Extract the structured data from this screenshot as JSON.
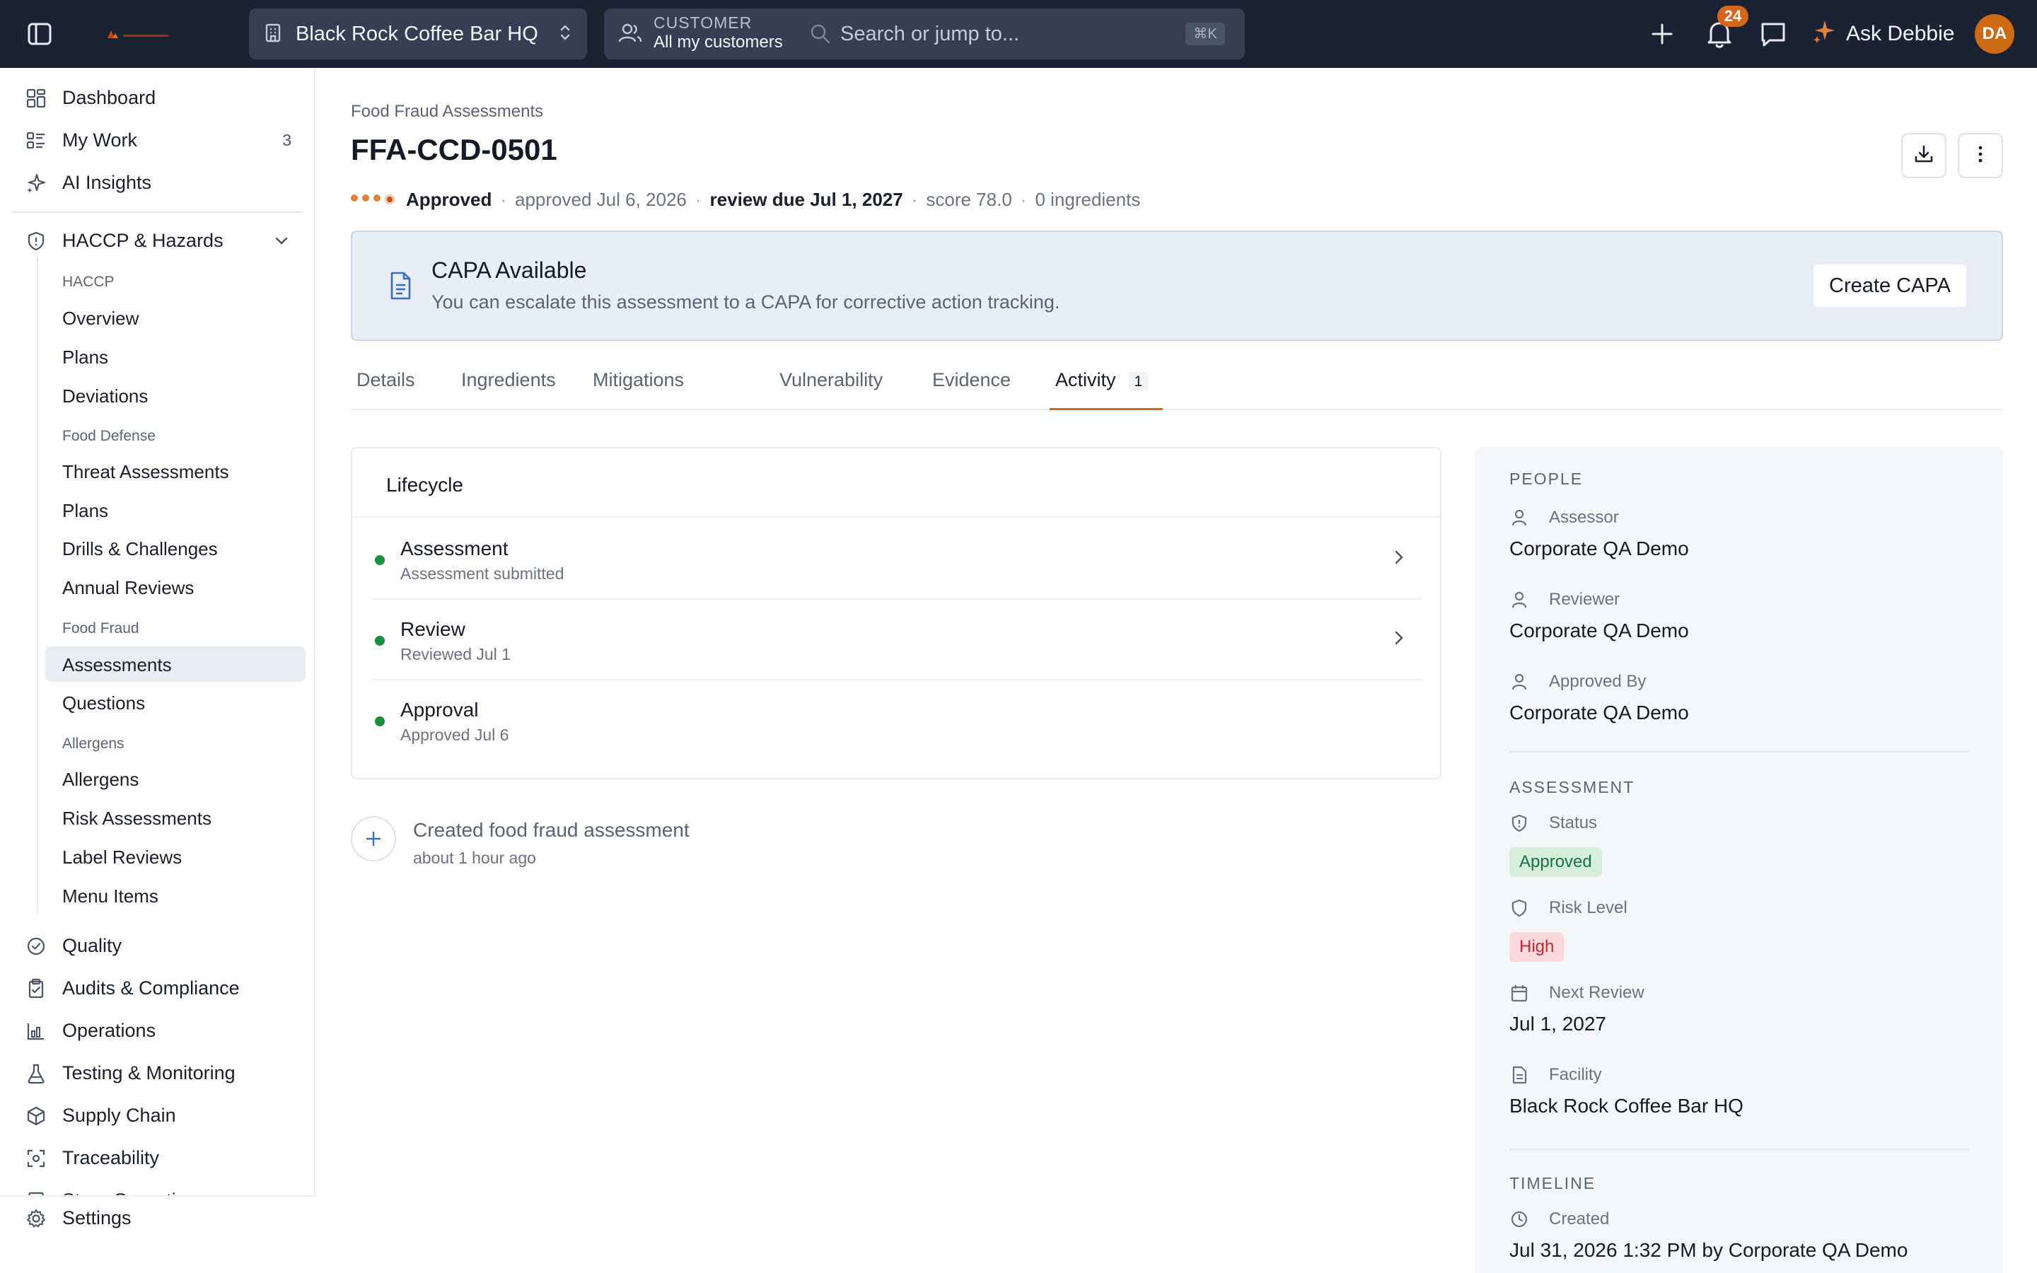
{
  "topbar": {
    "facility": "Black Rock Coffee Bar HQ",
    "customer_kicker": "CUSTOMER",
    "customer_value": "All my customers",
    "search_placeholder": "Search or jump to...",
    "search_shortcut": "⌘K",
    "notification_count": "24",
    "ask_label": "Ask Debbie",
    "avatar_initials": "DA",
    "accent_color": "#d5661a"
  },
  "sidebar": {
    "top_items": [
      {
        "label": "Dashboard",
        "icon": "dashboard-icon"
      },
      {
        "label": "My Work",
        "icon": "list-icon",
        "count": "3"
      },
      {
        "label": "AI Insights",
        "icon": "sparkle-icon"
      }
    ],
    "section": {
      "label": "HACCP & Hazards",
      "icon": "shield-icon"
    },
    "groups": [
      {
        "label": "HACCP",
        "items": [
          "Overview",
          "Plans",
          "Deviations"
        ]
      },
      {
        "label": "Food Defense",
        "items": [
          "Threat Assessments",
          "Plans",
          "Drills & Challenges",
          "Annual Reviews"
        ]
      },
      {
        "label": "Food Fraud",
        "items": [
          "Assessments",
          "Questions"
        ]
      },
      {
        "label": "Allergens",
        "items": [
          "Allergens",
          "Risk Assessments",
          "Label Reviews",
          "Menu Items"
        ]
      }
    ],
    "active_item": "Assessments",
    "bottom_items": [
      {
        "label": "Quality",
        "icon": "check-badge-icon"
      },
      {
        "label": "Audits & Compliance",
        "icon": "clipboard-icon"
      },
      {
        "label": "Operations",
        "icon": "chart-icon"
      },
      {
        "label": "Testing & Monitoring",
        "icon": "flask-icon"
      },
      {
        "label": "Supply Chain",
        "icon": "box-icon"
      },
      {
        "label": "Traceability",
        "icon": "scan-icon"
      },
      {
        "label": "Store Operations",
        "icon": "store-icon"
      }
    ],
    "settings_label": "Settings"
  },
  "page": {
    "breadcrumb": "Food Fraud Assessments",
    "title": "FFA-CCD-0501",
    "meta": {
      "status": "Approved",
      "approved": "approved Jul 6, 2026",
      "review_due": "review due Jul 1, 2027",
      "score": "score 78.0",
      "ingredients": "0 ingredients"
    }
  },
  "capa": {
    "title": "CAPA Available",
    "description": "You can escalate this assessment to a CAPA for corrective action tracking.",
    "button": "Create CAPA"
  },
  "tabs": [
    {
      "label": "Details"
    },
    {
      "label": "Ingredients"
    },
    {
      "label": "Mitigations"
    },
    {
      "label": "Vulnerability"
    },
    {
      "label": "Evidence"
    },
    {
      "label": "Activity",
      "count": "1"
    }
  ],
  "lifecycle": {
    "title": "Lifecycle",
    "steps": [
      {
        "name": "Assessment",
        "sub": "Assessment submitted"
      },
      {
        "name": "Review",
        "sub": "Reviewed Jul 1"
      },
      {
        "name": "Approval",
        "sub": "Approved Jul 6"
      }
    ]
  },
  "activity": {
    "text": "Created food fraud assessment",
    "time": "about 1 hour ago"
  },
  "panel": {
    "people_heading": "PEOPLE",
    "assessor_label": "Assessor",
    "assessor_value": "Corporate QA Demo",
    "reviewer_label": "Reviewer",
    "reviewer_value": "Corporate QA Demo",
    "approved_by_label": "Approved By",
    "approved_by_value": "Corporate QA Demo",
    "assessment_heading": "ASSESSMENT",
    "status_label": "Status",
    "status_value": "Approved",
    "risk_label": "Risk Level",
    "risk_value": "High",
    "next_review_label": "Next Review",
    "next_review_value": "Jul 1, 2027",
    "facility_label": "Facility",
    "facility_value": "Black Rock Coffee Bar HQ",
    "timeline_heading": "TIMELINE",
    "created_label": "Created",
    "created_value": "Jul 31, 2026 1:32 PM by Corporate QA Demo"
  }
}
